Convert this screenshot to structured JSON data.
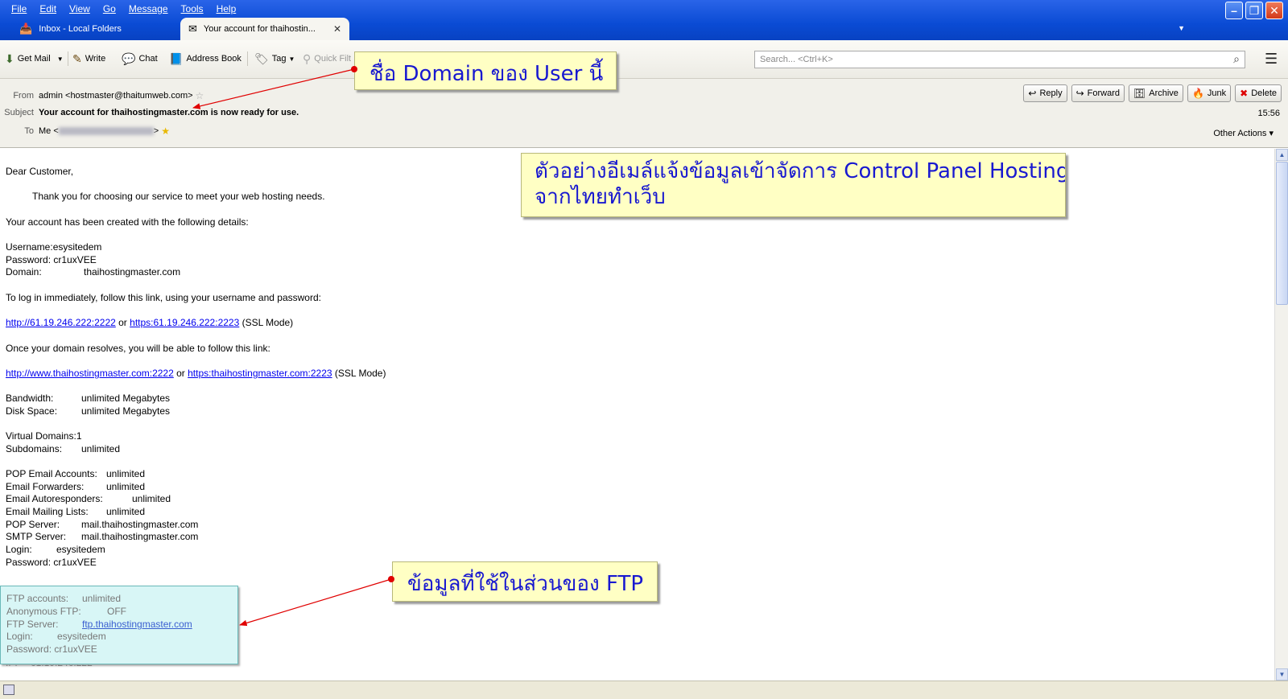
{
  "menu": [
    "File",
    "Edit",
    "View",
    "Go",
    "Message",
    "Tools",
    "Help"
  ],
  "tabs": [
    {
      "label": "Inbox - Local Folders",
      "icon": "inbox-icon"
    },
    {
      "label": "Your account for thaihostin...",
      "icon": "envelope-icon",
      "close": "✕"
    }
  ],
  "toolbar": {
    "get_mail": "Get Mail",
    "write": "Write",
    "chat": "Chat",
    "address_book": "Address Book",
    "tag": "Tag",
    "quick_filter": "Quick Filt",
    "search_placeholder": "Search... <Ctrl+K>"
  },
  "header": {
    "from_label": "From",
    "from_value": "admin <hostmaster@thaitumweb.com>",
    "subject_label": "Subject",
    "subject_value": "Your account for thaihostingmaster.com is now ready for use.",
    "to_label": "To",
    "to_prefix": "Me <",
    "to_suffix": ">",
    "time": "15:56",
    "other_actions": "Other Actions ▾",
    "buttons": {
      "reply": "Reply",
      "forward": "Forward",
      "archive": "Archive",
      "junk": "Junk",
      "delete": "Delete"
    }
  },
  "body": {
    "greeting": "Dear Customer,",
    "thanks": "Thank you for choosing our service to meet your web hosting needs.",
    "created": "Your account has been created with the following details:",
    "username": "Username:esysitedem",
    "password": "Password: cr1uxVEE",
    "domain_label": "Domain:",
    "domain_value": "thaihostingmaster.com",
    "login_instr": "To log in immediately, follow this link, using your username and password:",
    "link1": "http://61.19.246.222:2222",
    "or1": " or ",
    "link2": "https:61.19.246.222:2223",
    "ssl1": " (SSL Mode)",
    "resolves": "Once your domain resolves, you will be able to follow this link:",
    "link3": "http://www.thaihostingmaster.com:2222",
    "or2": " or ",
    "link4": "https:thaihostingmaster.com:2223",
    "ssl2": " (SSL Mode)",
    "bandwidth_label": "Bandwidth:",
    "bandwidth_value": "unlimited Megabytes",
    "disk_label": "Disk Space:",
    "disk_value": "unlimited Megabytes",
    "vdomains": "Virtual Domains:1",
    "subdomains_label": "Subdomains:",
    "subdomains_value": "unlimited",
    "pop_accounts_label": "POP Email Accounts:",
    "pop_accounts_value": "unlimited",
    "forwarders_label": "Email Forwarders:",
    "forwarders_value": "unlimited",
    "autoresp_label": "Email Autoresponders:",
    "autoresp_value": "unlimited",
    "mailing_label": "Email Mailing Lists:",
    "mailing_value": "unlimited",
    "pop_server_label": "POP Server:",
    "pop_server_value": "mail.thaihostingmaster.com",
    "smtp_label": "SMTP Server:",
    "smtp_value": "mail.thaihostingmaster.com",
    "login_label": "Login:",
    "login_value": "esysitedem",
    "password2": "Password: cr1uxVEE",
    "ftp_accounts_label": "FTP accounts:",
    "ftp_accounts_value": "unlimited",
    "anon_label": "Anonymous FTP:",
    "anon_value": "OFF",
    "ftp_server_label": "FTP Server:",
    "ftp_server_value": "ftp.thaihostingmaster.com",
    "ftp_login_label": "Login:",
    "ftp_login_value": "esysitedem",
    "ftp_password": "Password: cr1uxVEE",
    "ip_label": "IP:",
    "ip_value": "61.19.246.222"
  },
  "annotations": {
    "domain_callout": "ชื่อ Domain ของ User นี้",
    "main_callout_line1": "ตัวอย่างอีเมล์แจ้งข้อมูลเข้าจัดการ Control Panel Hosting",
    "main_callout_line2": "จากไทยทำเว็บ",
    "ftp_callout": "ข้อมูลที่ใช้ในส่วนของ FTP"
  },
  "colors": {
    "titlebar": "#0a4bd4",
    "callout_bg": "#ffffc4",
    "callout_text": "#1818d0",
    "ftp_box": "#d8f6f6",
    "arrow": "#e00000"
  }
}
